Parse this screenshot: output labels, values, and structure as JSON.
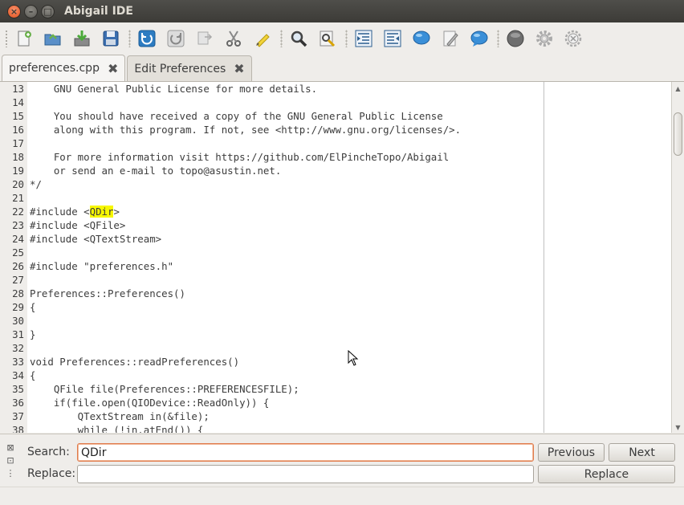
{
  "window": {
    "title": "Abigail IDE",
    "close_glyph": "×",
    "min_glyph": "–",
    "max_glyph": "□"
  },
  "toolbar": {
    "buttons": [
      {
        "name": "new-file",
        "icon": "new-file-icon"
      },
      {
        "name": "open-file",
        "icon": "open-folder-icon"
      },
      {
        "name": "save-file",
        "icon": "download-save-icon"
      },
      {
        "name": "save-as",
        "icon": "floppy-disk-icon"
      },
      {
        "name": "undo",
        "icon": "undo-icon"
      },
      {
        "name": "redo",
        "icon": "redo-icon"
      },
      {
        "name": "copy",
        "icon": "copy-icon"
      },
      {
        "name": "cut",
        "icon": "scissors-icon"
      },
      {
        "name": "paste",
        "icon": "paste-icon"
      },
      {
        "name": "find",
        "icon": "magnifier-icon"
      },
      {
        "name": "find-replace",
        "icon": "find-replace-icon"
      },
      {
        "name": "indent",
        "icon": "indent-icon"
      },
      {
        "name": "unindent",
        "icon": "unindent-icon"
      },
      {
        "name": "comment",
        "icon": "comment-bubble-icon"
      },
      {
        "name": "edit-note",
        "icon": "notepad-icon"
      },
      {
        "name": "uncomment",
        "icon": "speech-bubble-icon"
      },
      {
        "name": "stop",
        "icon": "stop-circle-icon"
      },
      {
        "name": "settings",
        "icon": "gear-icon"
      },
      {
        "name": "build-settings",
        "icon": "gear-tools-icon"
      }
    ]
  },
  "tabs": [
    {
      "label": "preferences.cpp",
      "close": "✖",
      "active": true
    },
    {
      "label": "Edit Preferences",
      "close": "✖",
      "active": false
    }
  ],
  "editor": {
    "lines": [
      {
        "n": "13",
        "pre": "    GNU General Public License for more details.",
        "hl": "",
        "post": ""
      },
      {
        "n": "14",
        "pre": "",
        "hl": "",
        "post": ""
      },
      {
        "n": "15",
        "pre": "    You should have received a copy of the GNU General Public License",
        "hl": "",
        "post": ""
      },
      {
        "n": "16",
        "pre": "    along with this program. If not, see <http://www.gnu.org/licenses/>.",
        "hl": "",
        "post": ""
      },
      {
        "n": "17",
        "pre": "",
        "hl": "",
        "post": ""
      },
      {
        "n": "18",
        "pre": "    For more information visit https://github.com/ElPincheTopo/Abigail",
        "hl": "",
        "post": ""
      },
      {
        "n": "19",
        "pre": "    or send an e-mail to topo@asustin.net.",
        "hl": "",
        "post": ""
      },
      {
        "n": "20",
        "pre": "*/",
        "hl": "",
        "post": ""
      },
      {
        "n": "21",
        "pre": "",
        "hl": "",
        "post": ""
      },
      {
        "n": "22",
        "pre": "#include <",
        "hl": "QDir",
        "post": ">"
      },
      {
        "n": "23",
        "pre": "#include <QFile>",
        "hl": "",
        "post": ""
      },
      {
        "n": "24",
        "pre": "#include <QTextStream>",
        "hl": "",
        "post": ""
      },
      {
        "n": "25",
        "pre": "",
        "hl": "",
        "post": ""
      },
      {
        "n": "26",
        "pre": "#include \"preferences.h\"",
        "hl": "",
        "post": ""
      },
      {
        "n": "27",
        "pre": "",
        "hl": "",
        "post": ""
      },
      {
        "n": "28",
        "pre": "Preferences::Preferences()",
        "hl": "",
        "post": ""
      },
      {
        "n": "29",
        "pre": "{",
        "hl": "",
        "post": ""
      },
      {
        "n": "30",
        "pre": "",
        "hl": "",
        "post": ""
      },
      {
        "n": "31",
        "pre": "}",
        "hl": "",
        "post": ""
      },
      {
        "n": "32",
        "pre": "",
        "hl": "",
        "post": ""
      },
      {
        "n": "33",
        "pre": "void Preferences::readPreferences()",
        "hl": "",
        "post": ""
      },
      {
        "n": "34",
        "pre": "{",
        "hl": "",
        "post": ""
      },
      {
        "n": "35",
        "pre": "    QFile file(Preferences::PREFERENCESFILE);",
        "hl": "",
        "post": ""
      },
      {
        "n": "36",
        "pre": "    if(file.open(QIODevice::ReadOnly)) {",
        "hl": "",
        "post": ""
      },
      {
        "n": "37",
        "pre": "        QTextStream in(&file);",
        "hl": "",
        "post": ""
      },
      {
        "n": "38",
        "pre": "        while (!in.atEnd()) {",
        "hl": "",
        "post": ""
      }
    ],
    "scroll_up_glyph": "▲",
    "scroll_down_glyph": "▼"
  },
  "search": {
    "search_label": "Search:",
    "search_value": "QDir",
    "replace_label": "Replace:",
    "replace_value": "",
    "previous_label": "Previous",
    "next_label": "Next",
    "replace_button_label": "Replace",
    "side_icons": [
      {
        "glyph": "⊠",
        "icon": "close-panel-icon"
      },
      {
        "glyph": "⊡",
        "icon": "float-panel-icon"
      },
      {
        "glyph": "⋮",
        "icon": "grip-icon"
      }
    ]
  },
  "colors": {
    "highlight": "#f7f700",
    "focus_border": "#e07a4a",
    "title_bar": "#3c3b37"
  }
}
